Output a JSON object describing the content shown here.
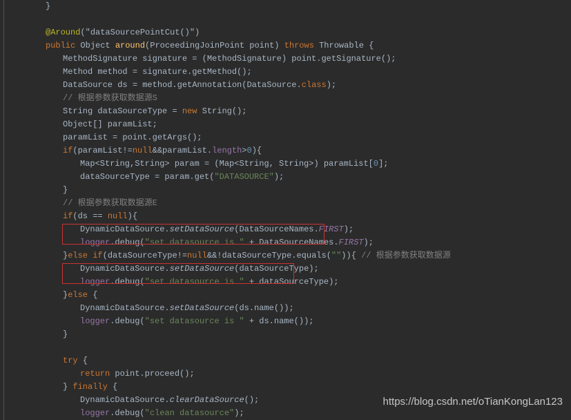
{
  "watermark": "https://blog.csdn.net/oTianKongLan123",
  "lines": {
    "l1_brace": "}",
    "l2_annotation": "@Around",
    "l2_annotation_arg": "(\"dataSourcePointCut()\")",
    "l3_public": "public",
    "l3_object": " Object ",
    "l3_around": "around",
    "l3_sig": "(ProceedingJoinPoint point) ",
    "l3_throws": "throws",
    "l3_throwable": " Throwable {",
    "l4": "MethodSignature signature = (MethodSignature) point.getSignature();",
    "l5": "Method method = signature.getMethod();",
    "l6_ds": "DataSource",
    "l6_mid": " ds = method.getAnnotation(",
    "l6_ds2": "DataSource",
    "l6_dot": ".",
    "l6_class": "class",
    "l6_end": ");",
    "l7_comment": "// 根据参数获取数据源S",
    "l8_a": "String dataSourceType = ",
    "l8_new": "new",
    "l8_b": " String();",
    "l9": "Object[] paramList;",
    "l10": "paramList = point.getArgs();",
    "l11_if": "if",
    "l11_a": "(paramList!=",
    "l11_null": "null",
    "l11_b": "&&paramList.",
    "l11_len": "length",
    "l11_c": ">",
    "l11_zero": "0",
    "l11_d": "){",
    "l12_a": "Map<String,String> param = (Map<String, String>) paramList[",
    "l12_zero": "0",
    "l12_b": "];",
    "l13_a": "dataSourceType = param.get(",
    "l13_str": "\"DATASOURCE\"",
    "l13_b": ");",
    "l14_brace": "}",
    "l15_comment": "// 根据参数获取数据源E",
    "l16_if": "if",
    "l16_a": "(ds == ",
    "l16_null": "null",
    "l16_b": "){",
    "l17_a": "DynamicDataSource.",
    "l17_set": "setDataSource",
    "l17_b": "(DataSourceNames.",
    "l17_first": "FIRST",
    "l17_c": ");",
    "l18_logger": "logger",
    "l18_a": ".debug(",
    "l18_str": "\"set datasource is \"",
    "l18_b": " + DataSourceNames.",
    "l18_first": "FIRST",
    "l18_c": ");",
    "l19_brace": "}",
    "l19_else": "else if",
    "l19_a": "(dataSourceType!=",
    "l19_null": "null",
    "l19_b": "&&!dataSourceType.equals(",
    "l19_empty": "\"\"",
    "l19_c": ")){ ",
    "l19_comment": "// 根据参数获取数据源",
    "l20_a": "DynamicDataSource.",
    "l20_set": "setDataSource",
    "l20_b": "(dataSourceType);",
    "l21_logger": "logger",
    "l21_a": ".debug(",
    "l21_str": "\"set datasource is \"",
    "l21_b": " + dataSourceType);",
    "l22_brace": "}",
    "l22_else": "else",
    "l22_open": " {",
    "l23_a": "DynamicDataSource.",
    "l23_set": "setDataSource",
    "l23_b": "(ds.name());",
    "l24_logger": "logger",
    "l24_a": ".debug(",
    "l24_str": "\"set datasource is \"",
    "l24_b": " + ds.name());",
    "l25_brace": "}",
    "l26_try": "try",
    "l26_open": " {",
    "l27_return": "return",
    "l27_a": " point.proceed();",
    "l28_brace": "} ",
    "l28_finally": "finally",
    "l28_open": " {",
    "l29_a": "DynamicDataSource.",
    "l29_clear": "clearDataSource",
    "l29_b": "();",
    "l30_logger": "logger",
    "l30_a": ".debug(",
    "l30_str": "\"clean datasource\"",
    "l30_b": ");"
  }
}
